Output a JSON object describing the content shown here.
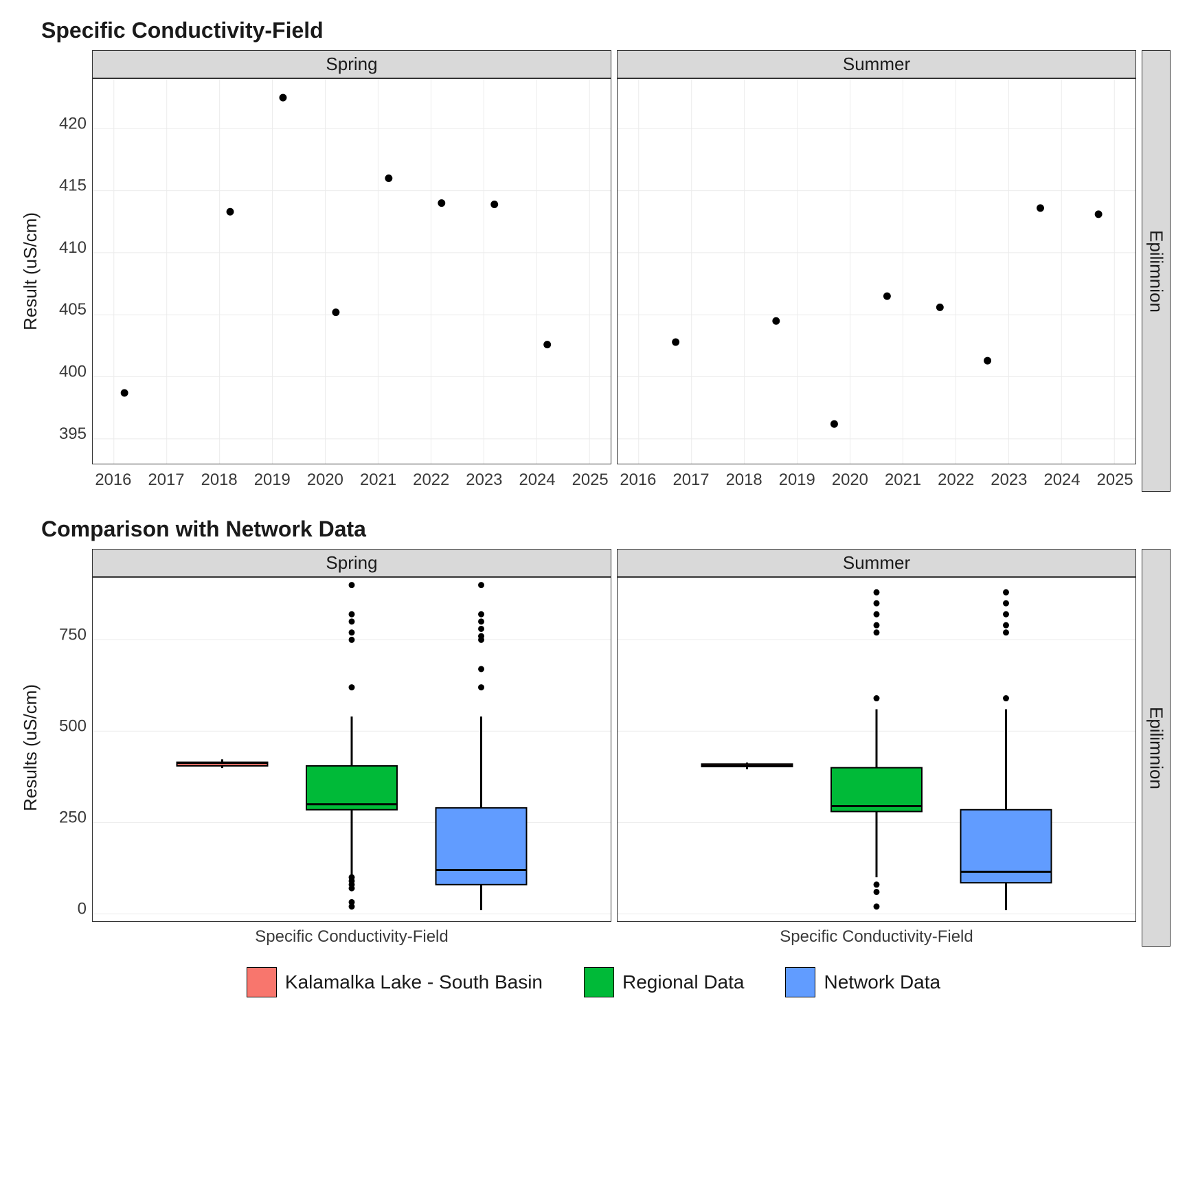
{
  "chart_data": [
    {
      "type": "scatter",
      "title": "Specific Conductivity-Field",
      "ylabel": "Result (uS/cm)",
      "strip_right": "Epilimnion",
      "x_ticks": [
        2016,
        2017,
        2018,
        2019,
        2020,
        2021,
        2022,
        2023,
        2024,
        2025
      ],
      "y_ticks": [
        395,
        400,
        405,
        410,
        415,
        420
      ],
      "xlim": [
        2015.6,
        2025.4
      ],
      "ylim": [
        393,
        424
      ],
      "facets": [
        {
          "label": "Spring",
          "points": [
            {
              "x": 2016.2,
              "y": 398.7
            },
            {
              "x": 2018.2,
              "y": 413.3
            },
            {
              "x": 2019.2,
              "y": 422.5
            },
            {
              "x": 2020.2,
              "y": 405.2
            },
            {
              "x": 2021.2,
              "y": 416.0
            },
            {
              "x": 2022.2,
              "y": 414.0
            },
            {
              "x": 2023.2,
              "y": 413.9
            },
            {
              "x": 2024.2,
              "y": 402.6
            }
          ]
        },
        {
          "label": "Summer",
          "points": [
            {
              "x": 2016.7,
              "y": 402.8
            },
            {
              "x": 2018.6,
              "y": 404.5
            },
            {
              "x": 2019.7,
              "y": 396.2
            },
            {
              "x": 2020.7,
              "y": 406.5
            },
            {
              "x": 2021.7,
              "y": 405.6
            },
            {
              "x": 2022.6,
              "y": 401.3
            },
            {
              "x": 2023.6,
              "y": 413.6
            },
            {
              "x": 2024.7,
              "y": 413.1
            }
          ]
        }
      ]
    },
    {
      "type": "box",
      "title": "Comparison with Network Data",
      "ylabel": "Results (uS/cm)",
      "xlabel": "Specific Conductivity-Field",
      "strip_right": "Epilimnion",
      "y_ticks": [
        0,
        250,
        500,
        750
      ],
      "ylim": [
        -20,
        920
      ],
      "legend": [
        "Kalamalka Lake - South Basin",
        "Regional Data",
        "Network Data"
      ],
      "colors": {
        "Kalamalka Lake - South Basin": "#f8766d",
        "Regional Data": "#00ba38",
        "Network Data": "#619cff"
      },
      "facets": [
        {
          "label": "Spring",
          "boxes": [
            {
              "series": "Kalamalka Lake - South Basin",
              "min": 399,
              "q1": 405,
              "median": 413,
              "q3": 415,
              "max": 423,
              "outliers": []
            },
            {
              "series": "Regional Data",
              "min": 76,
              "q1": 285,
              "median": 300,
              "q3": 405,
              "max": 540,
              "outliers": [
                20,
                32,
                70,
                80,
                90,
                100,
                620,
                750,
                770,
                800,
                820,
                900
              ]
            },
            {
              "series": "Network Data",
              "min": 10,
              "q1": 80,
              "median": 120,
              "q3": 290,
              "max": 540,
              "outliers": [
                620,
                670,
                750,
                760,
                780,
                800,
                820,
                900
              ]
            }
          ]
        },
        {
          "label": "Summer",
          "boxes": [
            {
              "series": "Kalamalka Lake - South Basin",
              "min": 396,
              "q1": 403,
              "median": 405,
              "q3": 410,
              "max": 414,
              "outliers": []
            },
            {
              "series": "Regional Data",
              "min": 100,
              "q1": 280,
              "median": 295,
              "q3": 400,
              "max": 560,
              "outliers": [
                20,
                60,
                80,
                590,
                770,
                790,
                820,
                850,
                880
              ]
            },
            {
              "series": "Network Data",
              "min": 10,
              "q1": 85,
              "median": 115,
              "q3": 285,
              "max": 560,
              "outliers": [
                590,
                770,
                790,
                820,
                850,
                880
              ]
            }
          ]
        }
      ]
    }
  ]
}
